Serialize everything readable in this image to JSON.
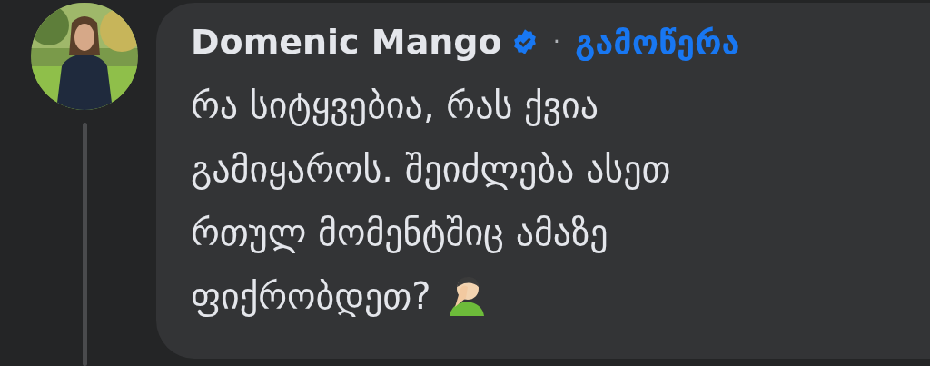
{
  "comment": {
    "author": "Domenic Mango",
    "verified": true,
    "separator": "·",
    "follow": "გამოწერა",
    "text_lines": [
      "რა სიტყვებია, რას ქვია",
      "გამიყაროს. შეიძლება ასეთ",
      "რთულ მომენტშიც ამაზე",
      "ფიქრობდეთ?"
    ]
  }
}
